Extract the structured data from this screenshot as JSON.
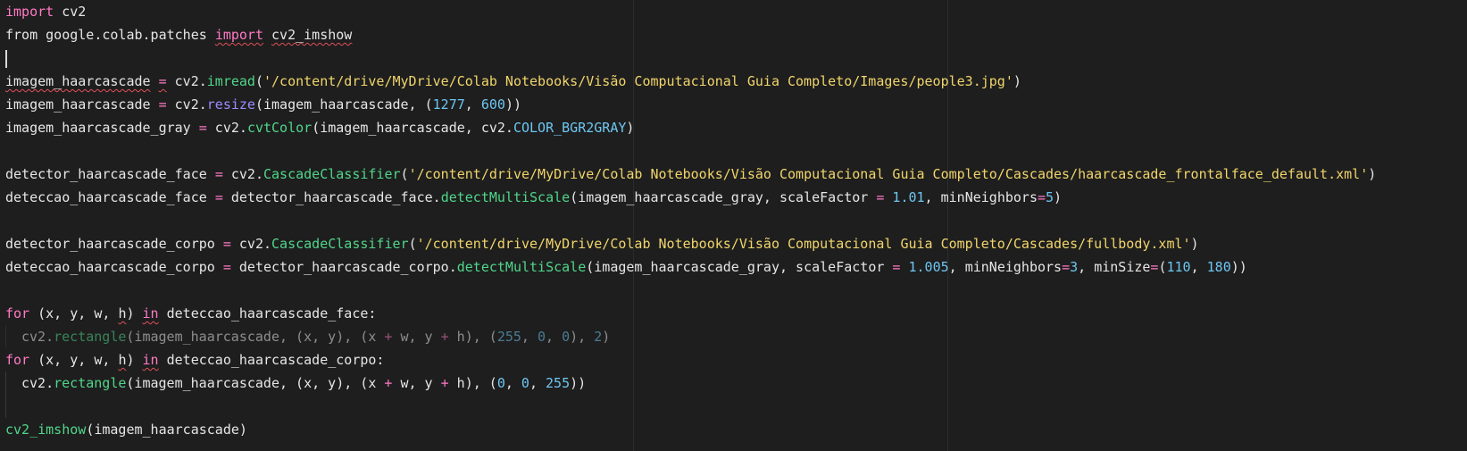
{
  "editor": {
    "language": "python",
    "theme_colors": {
      "background": "#1e1e1e",
      "keyword": "#ff79c6",
      "method": "#50d68a",
      "string": "#f1d56b",
      "number": "#6ec6f2",
      "text": "#e6e6e6",
      "error_squiggle": "#e0505a"
    },
    "lines": [
      {
        "kind": "code",
        "indent": false,
        "dim": false,
        "tokens": [
          {
            "t": "kw",
            "v": "import"
          },
          {
            "t": "plain",
            "v": " cv2"
          }
        ]
      },
      {
        "kind": "code",
        "indent": false,
        "dim": false,
        "tokens": [
          {
            "t": "plain",
            "v": "from google.colab.patches "
          },
          {
            "t": "kw",
            "v": "import",
            "sq": true
          },
          {
            "t": "plain",
            "v": " "
          },
          {
            "t": "plain",
            "v": "cv2_imshow",
            "sq": true
          }
        ]
      },
      {
        "kind": "caret",
        "indent": false,
        "dim": false,
        "tokens": []
      },
      {
        "kind": "code",
        "indent": false,
        "dim": false,
        "tokens": [
          {
            "t": "plain",
            "v": "imagem_haarcascade",
            "sq": true
          },
          {
            "t": "plain",
            "v": " "
          },
          {
            "t": "op",
            "v": "=",
            "sq": true
          },
          {
            "t": "plain",
            "v": " cv2."
          },
          {
            "t": "gfn",
            "v": "imread"
          },
          {
            "t": "plain",
            "v": "("
          },
          {
            "t": "str",
            "v": "'/content/drive/MyDrive/Colab Notebooks/Visão Computacional Guia Completo/Images/people3.jpg'"
          },
          {
            "t": "plain",
            "v": ")"
          }
        ]
      },
      {
        "kind": "code",
        "indent": false,
        "dim": false,
        "tokens": [
          {
            "t": "plain",
            "v": "imagem_haarcascade "
          },
          {
            "t": "op",
            "v": "="
          },
          {
            "t": "plain",
            "v": " cv2."
          },
          {
            "t": "fn",
            "v": "resize"
          },
          {
            "t": "plain",
            "v": "(imagem_haarcascade, ("
          },
          {
            "t": "num",
            "v": "1277"
          },
          {
            "t": "plain",
            "v": ", "
          },
          {
            "t": "num",
            "v": "600"
          },
          {
            "t": "plain",
            "v": "))"
          }
        ]
      },
      {
        "kind": "code",
        "indent": false,
        "dim": false,
        "tokens": [
          {
            "t": "plain",
            "v": "imagem_haarcascade_gray "
          },
          {
            "t": "op",
            "v": "="
          },
          {
            "t": "plain",
            "v": " cv2."
          },
          {
            "t": "gfn",
            "v": "cvtColor"
          },
          {
            "t": "plain",
            "v": "(imagem_haarcascade, cv2."
          },
          {
            "t": "const",
            "v": "COLOR_BGR2GRAY"
          },
          {
            "t": "plain",
            "v": ")"
          }
        ]
      },
      {
        "kind": "blank",
        "indent": false,
        "dim": false,
        "tokens": []
      },
      {
        "kind": "code",
        "indent": false,
        "dim": false,
        "tokens": [
          {
            "t": "plain",
            "v": "detector_haarcascade_face "
          },
          {
            "t": "op",
            "v": "="
          },
          {
            "t": "plain",
            "v": " cv2."
          },
          {
            "t": "gfn",
            "v": "CascadeClassifier"
          },
          {
            "t": "plain",
            "v": "("
          },
          {
            "t": "str",
            "v": "'/content/drive/MyDrive/Colab Notebooks/Visão Computacional Guia Completo/Cascades/haarcascade_frontalface_default.xml'"
          },
          {
            "t": "plain",
            "v": ")"
          }
        ]
      },
      {
        "kind": "code",
        "indent": false,
        "dim": false,
        "tokens": [
          {
            "t": "plain",
            "v": "deteccao_haarcascade_face "
          },
          {
            "t": "op",
            "v": "="
          },
          {
            "t": "plain",
            "v": " detector_haarcascade_face."
          },
          {
            "t": "gfn",
            "v": "detectMultiScale"
          },
          {
            "t": "plain",
            "v": "(imagem_haarcascade_gray, scaleFactor "
          },
          {
            "t": "op",
            "v": "="
          },
          {
            "t": "plain",
            "v": " "
          },
          {
            "t": "num",
            "v": "1.01"
          },
          {
            "t": "plain",
            "v": ", minNeighbors"
          },
          {
            "t": "op",
            "v": "="
          },
          {
            "t": "num",
            "v": "5"
          },
          {
            "t": "plain",
            "v": ")"
          }
        ]
      },
      {
        "kind": "blank",
        "indent": false,
        "dim": false,
        "tokens": []
      },
      {
        "kind": "code",
        "indent": false,
        "dim": false,
        "tokens": [
          {
            "t": "plain",
            "v": "detector_haarcascade_corpo "
          },
          {
            "t": "op",
            "v": "="
          },
          {
            "t": "plain",
            "v": " cv2."
          },
          {
            "t": "gfn",
            "v": "CascadeClassifier"
          },
          {
            "t": "plain",
            "v": "("
          },
          {
            "t": "str",
            "v": "'/content/drive/MyDrive/Colab Notebooks/Visão Computacional Guia Completo/Cascades/fullbody.xml'"
          },
          {
            "t": "plain",
            "v": ")"
          }
        ]
      },
      {
        "kind": "code",
        "indent": false,
        "dim": false,
        "tokens": [
          {
            "t": "plain",
            "v": "deteccao_haarcascade_corpo "
          },
          {
            "t": "op",
            "v": "="
          },
          {
            "t": "plain",
            "v": " detector_haarcascade_corpo."
          },
          {
            "t": "gfn",
            "v": "detectMultiScale"
          },
          {
            "t": "plain",
            "v": "(imagem_haarcascade_gray, scaleFactor "
          },
          {
            "t": "op",
            "v": "="
          },
          {
            "t": "plain",
            "v": " "
          },
          {
            "t": "num",
            "v": "1.005"
          },
          {
            "t": "plain",
            "v": ", minNeighbors"
          },
          {
            "t": "op",
            "v": "="
          },
          {
            "t": "num",
            "v": "3"
          },
          {
            "t": "plain",
            "v": ", minSize"
          },
          {
            "t": "op",
            "v": "="
          },
          {
            "t": "plain",
            "v": "("
          },
          {
            "t": "num",
            "v": "110"
          },
          {
            "t": "plain",
            "v": ", "
          },
          {
            "t": "num",
            "v": "180"
          },
          {
            "t": "plain",
            "v": "))"
          }
        ]
      },
      {
        "kind": "blank",
        "indent": false,
        "dim": false,
        "tokens": []
      },
      {
        "kind": "code",
        "indent": false,
        "dim": false,
        "tokens": [
          {
            "t": "kw",
            "v": "for"
          },
          {
            "t": "plain",
            "v": " (x, y, w, "
          },
          {
            "t": "plain",
            "v": "h",
            "sq": true
          },
          {
            "t": "plain",
            "v": ") "
          },
          {
            "t": "kw",
            "v": "in",
            "sq": true
          },
          {
            "t": "plain",
            "v": " deteccao_haarcascade_face:"
          }
        ]
      },
      {
        "kind": "code",
        "indent": true,
        "dim": true,
        "tokens": [
          {
            "t": "plain",
            "v": "cv2."
          },
          {
            "t": "gfn",
            "v": "rectangle"
          },
          {
            "t": "plain",
            "v": "(imagem_haarcascade, (x, y), (x "
          },
          {
            "t": "op",
            "v": "+"
          },
          {
            "t": "plain",
            "v": " w, y "
          },
          {
            "t": "op",
            "v": "+"
          },
          {
            "t": "plain",
            "v": " h), ("
          },
          {
            "t": "num",
            "v": "255"
          },
          {
            "t": "plain",
            "v": ", "
          },
          {
            "t": "num",
            "v": "0"
          },
          {
            "t": "plain",
            "v": ", "
          },
          {
            "t": "num",
            "v": "0"
          },
          {
            "t": "plain",
            "v": "), "
          },
          {
            "t": "num",
            "v": "2"
          },
          {
            "t": "plain",
            "v": ")"
          }
        ]
      },
      {
        "kind": "code",
        "indent": false,
        "dim": false,
        "tokens": [
          {
            "t": "kw",
            "v": "for"
          },
          {
            "t": "plain",
            "v": " (x, y, w, "
          },
          {
            "t": "plain",
            "v": "h",
            "sq": true
          },
          {
            "t": "plain",
            "v": ") "
          },
          {
            "t": "kw",
            "v": "in",
            "sq": true
          },
          {
            "t": "plain",
            "v": " deteccao_haarcascade_corpo:"
          }
        ]
      },
      {
        "kind": "code",
        "indent": true,
        "dim": false,
        "tokens": [
          {
            "t": "plain",
            "v": "cv2."
          },
          {
            "t": "gfn",
            "v": "rectangle"
          },
          {
            "t": "plain",
            "v": "(imagem_haarcascade, (x, y), (x "
          },
          {
            "t": "op",
            "v": "+"
          },
          {
            "t": "plain",
            "v": " w, y "
          },
          {
            "t": "op",
            "v": "+"
          },
          {
            "t": "plain",
            "v": " h), ("
          },
          {
            "t": "num",
            "v": "0"
          },
          {
            "t": "plain",
            "v": ", "
          },
          {
            "t": "num",
            "v": "0"
          },
          {
            "t": "plain",
            "v": ", "
          },
          {
            "t": "num",
            "v": "255"
          },
          {
            "t": "plain",
            "v": "))"
          }
        ]
      },
      {
        "kind": "blank",
        "indent": true,
        "dim": false,
        "tokens": []
      },
      {
        "kind": "code",
        "indent": false,
        "dim": false,
        "tokens": [
          {
            "t": "gfn",
            "v": "cv2_imshow"
          },
          {
            "t": "plain",
            "v": "(imagem_haarcascade)"
          }
        ]
      }
    ]
  }
}
